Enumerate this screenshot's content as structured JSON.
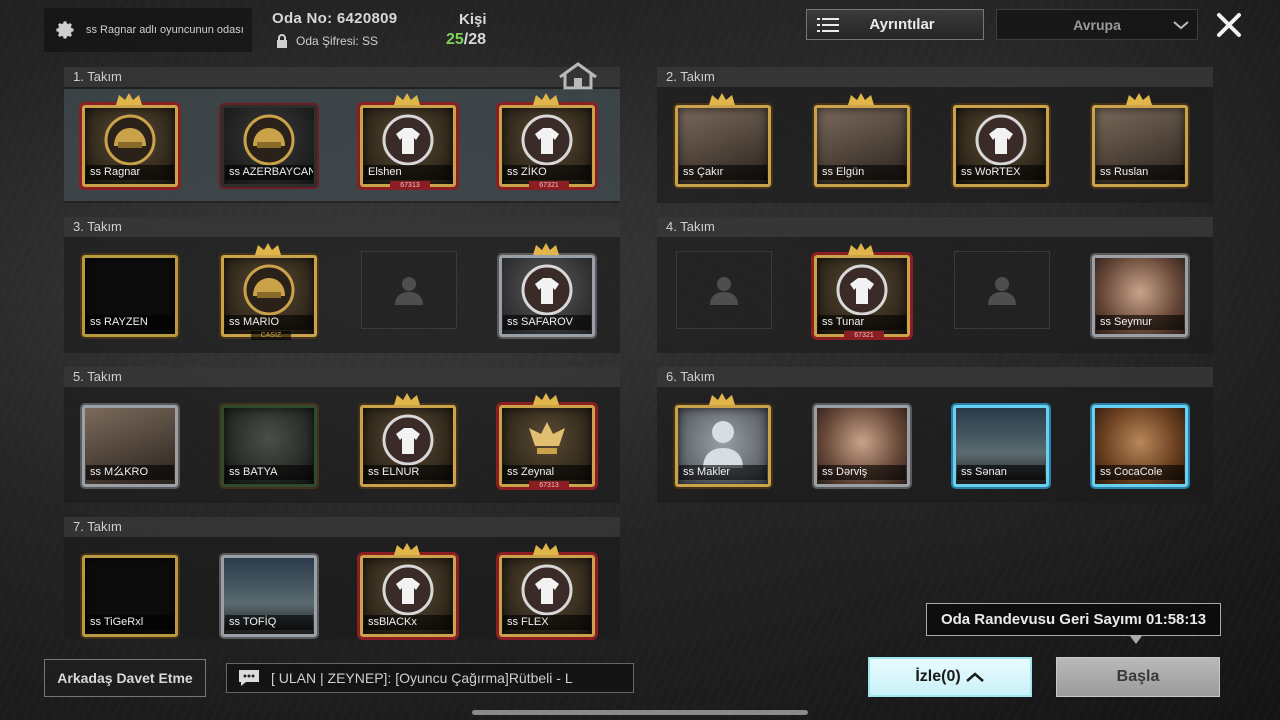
{
  "header": {
    "room_owner": "ss Ragnar adlı oyuncunun odası",
    "room_no": "Oda No: 6420809",
    "room_password": "Oda Şifresi: SS",
    "people_label": "Kişi",
    "people_current": "25",
    "people_max": "/28",
    "details_label": "Ayrıntılar",
    "region_value": "Avrupa"
  },
  "teams": [
    {
      "label": "1. Takım",
      "players": [
        {
          "name": "ss Ragnar",
          "tag": ""
        },
        {
          "name": "ss AZERBAYCAN",
          "tag": ""
        },
        {
          "name": "Elshen",
          "tag": "67313"
        },
        {
          "name": "ss ZİKO",
          "tag": "67321"
        }
      ]
    },
    {
      "label": "2. Takım",
      "players": [
        {
          "name": "ss Çakır",
          "tag": ""
        },
        {
          "name": "ss Elgün",
          "tag": ""
        },
        {
          "name": "ss WoRTEX",
          "tag": ""
        },
        {
          "name": "ss Ruslan",
          "tag": ""
        }
      ]
    },
    {
      "label": "3. Takım",
      "players": [
        {
          "name": "ss RAYZEN",
          "tag": ""
        },
        {
          "name": "ss MARIO",
          "tag": "CASIZ"
        },
        {
          "name": "",
          "tag": ""
        },
        {
          "name": "ss SAFAROV",
          "tag": ""
        }
      ]
    },
    {
      "label": "4. Takım",
      "players": [
        {
          "name": "",
          "tag": ""
        },
        {
          "name": "ss Tunar",
          "tag": "67321"
        },
        {
          "name": "",
          "tag": ""
        },
        {
          "name": "ss Seymur",
          "tag": ""
        }
      ]
    },
    {
      "label": "5. Takım",
      "players": [
        {
          "name": "ss M么KRO",
          "tag": ""
        },
        {
          "name": "ss BATYA",
          "tag": ""
        },
        {
          "name": "ss ELNUR",
          "tag": ""
        },
        {
          "name": "ss Zeynal",
          "tag": "67313"
        }
      ]
    },
    {
      "label": "6. Takım",
      "players": [
        {
          "name": "ss Makler",
          "tag": ""
        },
        {
          "name": "ss Dərviş",
          "tag": ""
        },
        {
          "name": "ss Sənan",
          "tag": ""
        },
        {
          "name": "ss CocaCole",
          "tag": ""
        }
      ]
    },
    {
      "label": "7. Takım",
      "players": [
        {
          "name": "ss TiGeRxl",
          "tag": ""
        },
        {
          "name": "ss TOFİQ",
          "tag": ""
        },
        {
          "name": "ssBlACKx",
          "tag": ""
        },
        {
          "name": "ss FLEX",
          "tag": ""
        }
      ]
    }
  ],
  "footer": {
    "invite_label": "Arkadaş Davet Etme",
    "chat_text": "[ ULAN | ZEYNEP]: [Oyuncu Çağırma]Rütbeli - L",
    "countdown": "Oda Randevusu Geri Sayımı 01:58:13",
    "watch_label": "İzle(0)",
    "start_label": "Başla"
  },
  "colors": {
    "accent_gold": "#c9a24a",
    "watch_bg": "#d9f6fa",
    "people_current": "#7dd45a"
  },
  "icons": [
    "gear-icon",
    "lock-icon",
    "list-icon",
    "chevron-down-icon",
    "close-icon",
    "home-icon",
    "chat-icon",
    "chevron-up-icon",
    "person-icon"
  ]
}
